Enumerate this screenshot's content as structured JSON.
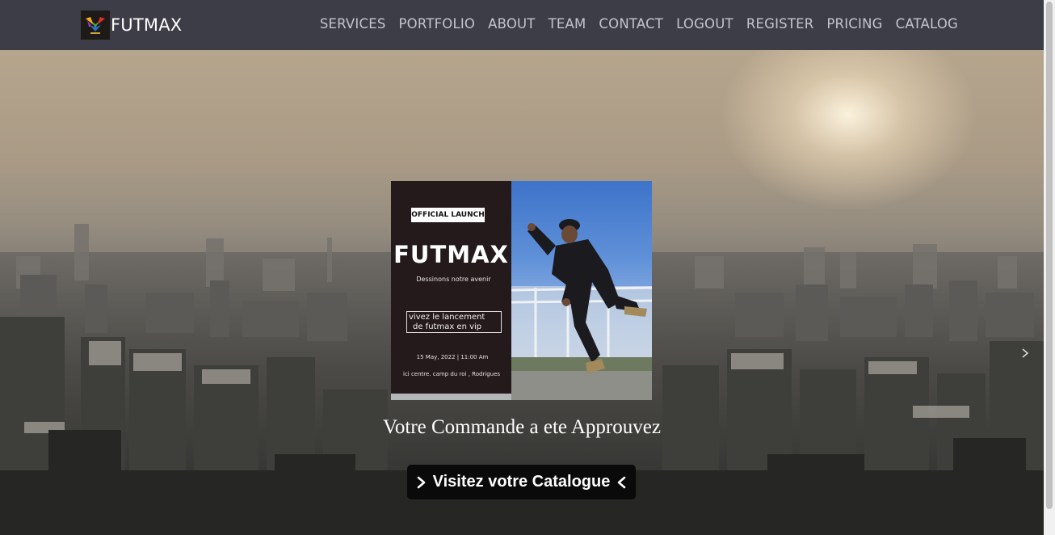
{
  "navbar": {
    "brand": "FUTMAX",
    "links": [
      "SERVICES",
      "PORTFOLIO",
      "ABOUT",
      "TEAM",
      "CONTACT",
      "LOGOUT",
      "REGISTER",
      "PRICING",
      "CATALOG"
    ]
  },
  "poster": {
    "tag": "OFFICIAL LAUNCH",
    "title": "FUTMAX",
    "subtitle": "Dessinons notre avenir",
    "invite_line1": "vivez le lancement",
    "invite_line2": "de futmax en vip",
    "date": "15 May, 2022 | 11:00 Am",
    "address": "ici centre. camp du roi , Rodrigues"
  },
  "hero": {
    "message": "Votre Commande a ete Approuvez",
    "button_label": "Visitez votre Catalogue"
  },
  "icons": {
    "brand_logo": "colorful-bird-logo-icon",
    "button_left": "chevron-right-icon",
    "button_right": "chevron-left-icon",
    "slider_next": "chevron-right-icon"
  },
  "colors": {
    "navbar_bg": "#3d3d47",
    "nav_link": "#c4c4cb",
    "button_bg": "#0a0a0a",
    "poster_dark": "#241a1b"
  }
}
